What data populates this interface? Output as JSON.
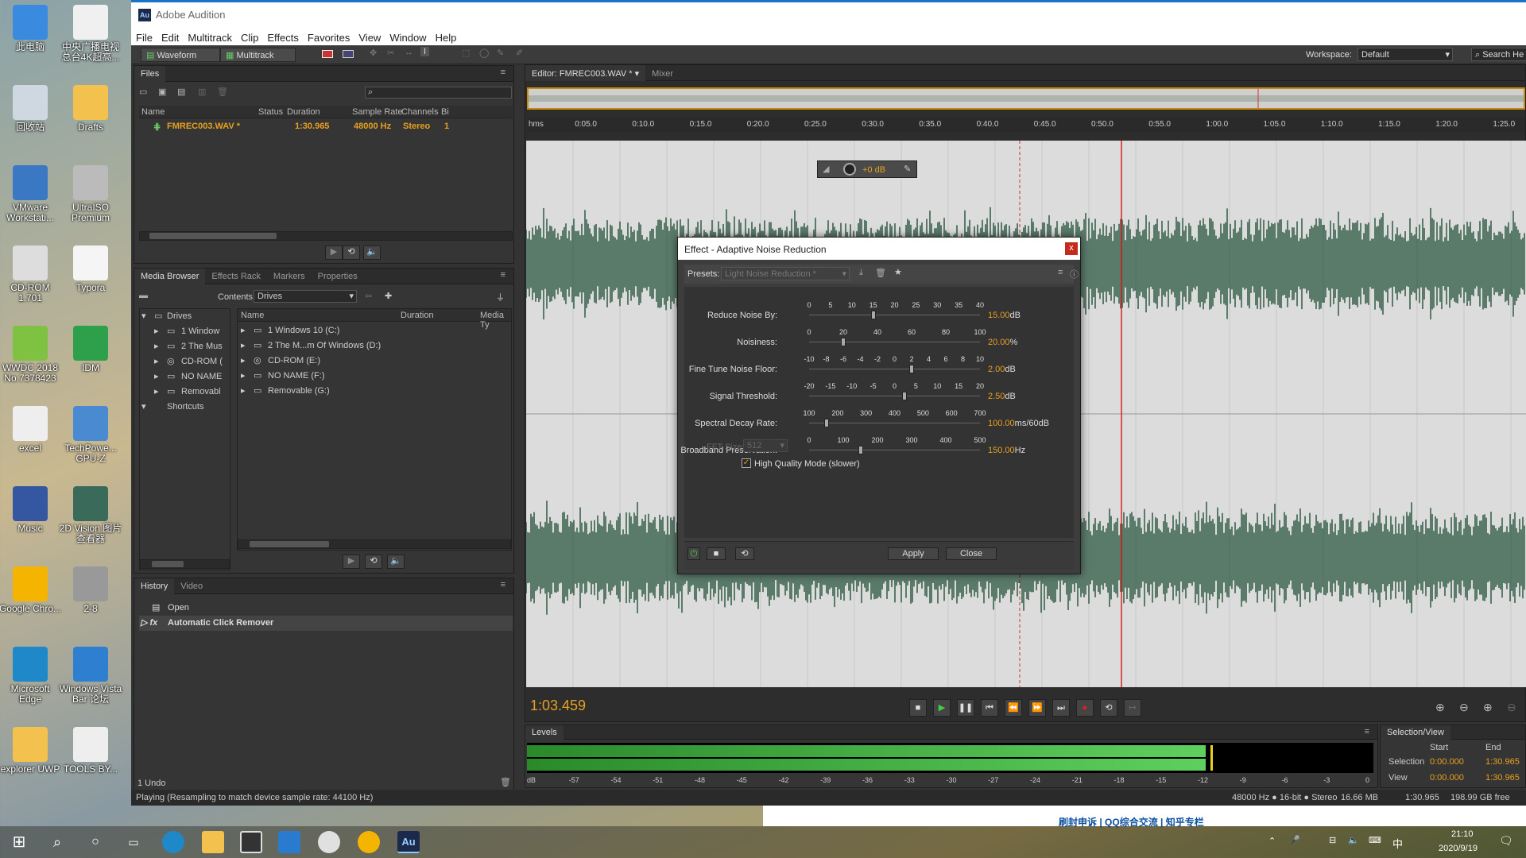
{
  "desktop": {
    "icons": [
      {
        "label": "此电脑",
        "color": "#3a8be0"
      },
      {
        "label": "中央广播电视总台4K超高...",
        "color": "#f0f0f0"
      },
      {
        "label": "回收站",
        "color": "#cfd8e0"
      },
      {
        "label": "Drafts",
        "color": "#f2c14e"
      },
      {
        "label": "VMware Workstati...",
        "color": "#3b78c4"
      },
      {
        "label": "UltraISO Premium",
        "color": "#bbb"
      },
      {
        "label": "CD-ROM 1.701",
        "color": "#ddd"
      },
      {
        "label": "Typora",
        "color": "#f5f5f5"
      },
      {
        "label": "WWDC 2018 No.7378423",
        "color": "#7fc241"
      },
      {
        "label": "IDM",
        "color": "#2e9f4a"
      },
      {
        "label": "excel",
        "color": "#eee"
      },
      {
        "label": "TechPowe... GPU-Z",
        "color": "#4a8ad0"
      },
      {
        "label": "Music",
        "color": "#3556a0"
      },
      {
        "label": "2D Vision 图片查看器",
        "color": "#3a6a5a"
      },
      {
        "label": "Google Chro...",
        "color": "#f4b400"
      },
      {
        "label": "2-8",
        "color": "#999"
      },
      {
        "label": "Microsoft Edge",
        "color": "#1e88c8"
      },
      {
        "label": "Windows Vista Bar 论坛",
        "color": "#2f7fd0"
      },
      {
        "label": "explorer UWP",
        "color": "#f2c14e"
      },
      {
        "label": "TOOLS BY...",
        "color": "#eee"
      }
    ]
  },
  "app": {
    "title": "Adobe Audition",
    "logo": "Au",
    "menu": [
      "File",
      "Edit",
      "Multitrack",
      "Clip",
      "Effects",
      "Favorites",
      "View",
      "Window",
      "Help"
    ],
    "toolbar": {
      "waveform": "Waveform",
      "multitrack": "Multitrack",
      "workspace_label": "Workspace:",
      "workspace_value": "Default",
      "search": "Search He"
    },
    "files": {
      "tab": "Files",
      "columns": {
        "name": "Name",
        "status": "Status",
        "duration": "Duration",
        "rate": "Sample Rate",
        "channels": "Channels",
        "bits": "Bi"
      },
      "row": {
        "name": "FMREC003.WAV *",
        "duration": "1:30.965",
        "rate": "48000 Hz",
        "channels": "Stereo",
        "bits": "1"
      }
    },
    "media": {
      "tabs": [
        "Media Browser",
        "Effects Rack",
        "Markers",
        "Properties"
      ],
      "contents_label": "Contents:",
      "contents_value": "Drives",
      "tree": [
        "Drives",
        "1 Window",
        "2 The Mus",
        "CD-ROM (",
        "NO NAME",
        "Removabl",
        "Shortcuts"
      ],
      "columns": {
        "name": "Name",
        "duration": "Duration",
        "media": "Media Ty"
      },
      "items": [
        "1 Windows 10 (C:)",
        "2 The M...m Of Windows (D:)",
        "CD-ROM (E:)",
        "NO NAME (F:)",
        "Removable (G:)"
      ]
    },
    "history": {
      "tabs": [
        "History",
        "Video"
      ],
      "items": [
        "Open",
        "Automatic Click Remover"
      ],
      "undo": "1 Undo"
    },
    "editor": {
      "tab": "Editor: FMREC003.WAV *",
      "mixer": "Mixer",
      "ruler": [
        "hms",
        "0:05.0",
        "0:10.0",
        "0:15.0",
        "0:20.0",
        "0:25.0",
        "0:30.0",
        "0:35.0",
        "0:40.0",
        "0:45.0",
        "0:50.0",
        "0:55.0",
        "1:00.0",
        "1:05.0",
        "1:10.0",
        "1:15.0",
        "1:20.0",
        "1:25.0"
      ],
      "hud": "+0 dB",
      "time": "1:03.459"
    },
    "levels": {
      "tab": "Levels",
      "scale": [
        "dB",
        "-57",
        "-54",
        "-51",
        "-48",
        "-45",
        "-42",
        "-39",
        "-36",
        "-33",
        "-30",
        "-27",
        "-24",
        "-21",
        "-18",
        "-15",
        "-12",
        "-9",
        "-6",
        "-3",
        "0"
      ]
    },
    "selection": {
      "tab": "Selection/View",
      "start": "Start",
      "end": "End",
      "sel_label": "Selection",
      "sel_start": "0:00.000",
      "sel_end": "1:30.965",
      "view_label": "View",
      "view_start": "0:00.000",
      "view_end": "1:30.965"
    },
    "status": {
      "left": "Playing (Resampling to match device sample rate: 44100 Hz)",
      "format": "48000 Hz ● 16-bit ● Stereo",
      "size": "16.66 MB",
      "duration": "1:30.965",
      "free": "198.99 GB free"
    }
  },
  "dialog": {
    "title": "Effect - Adaptive Noise Reduction",
    "close": "x",
    "presets_label": "Presets:",
    "preset_value": "Light Noise Reduction *",
    "sliders": [
      {
        "label": "Reduce Noise By:",
        "ticks": [
          "0",
          "5",
          "10",
          "15",
          "20",
          "25",
          "30",
          "35",
          "40"
        ],
        "value": "15.00",
        "unit": "dB",
        "pos": 0.375
      },
      {
        "label": "Noisiness:",
        "ticks": [
          "0",
          "20",
          "40",
          "60",
          "80",
          "100"
        ],
        "value": "20.00",
        "unit": "%",
        "pos": 0.2
      },
      {
        "label": "Fine Tune Noise Floor:",
        "ticks": [
          "-10",
          "-8",
          "-6",
          "-4",
          "-2",
          "0",
          "2",
          "4",
          "6",
          "8",
          "10"
        ],
        "value": "2.00",
        "unit": "dB",
        "pos": 0.6
      },
      {
        "label": "Signal Threshold:",
        "ticks": [
          "-20",
          "-15",
          "-10",
          "-5",
          "0",
          "5",
          "10",
          "15",
          "20"
        ],
        "value": "2.50",
        "unit": "dB",
        "pos": 0.56
      },
      {
        "label": "Spectral Decay Rate:",
        "ticks": [
          "100",
          "200",
          "300",
          "400",
          "500",
          "600",
          "700"
        ],
        "value": "100.00",
        "unit": "ms/60dB",
        "pos": 0.1
      },
      {
        "label": "Broadband Preservation:",
        "ticks": [
          "0",
          "100",
          "200",
          "300",
          "400",
          "500"
        ],
        "value": "150.00",
        "unit": "Hz",
        "pos": 0.3
      }
    ],
    "fft_label": "FFT Size:",
    "fft_value": "512",
    "hq": "High Quality Mode (slower)",
    "apply": "Apply",
    "close_btn": "Close"
  },
  "taskbar": {
    "time": "21:10",
    "date": "2020/9/19",
    "ime": "中",
    "links": "刷封申诉 | QQ综合交流 | 知乎专栏"
  }
}
